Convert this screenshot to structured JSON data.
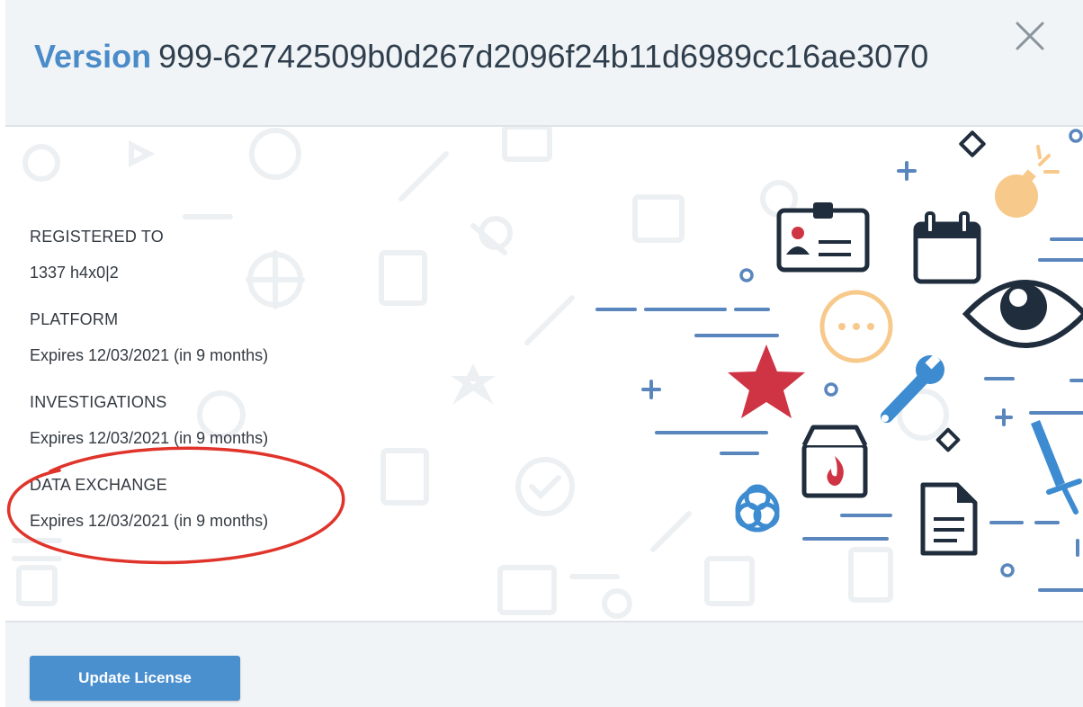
{
  "modal": {
    "title_keyword": "Version",
    "title_value": "999-62742509b0d267d2096f24b11d6989cc16ae3070",
    "close_icon": "close-icon"
  },
  "license": {
    "registered_label": "REGISTERED TO",
    "registered_value": "1337 h4x0|2",
    "sections": [
      {
        "label": "PLATFORM",
        "value": "Expires 12/03/2021 (in 9 months)"
      },
      {
        "label": "INVESTIGATIONS",
        "value": "Expires 12/03/2021 (in 9 months)"
      },
      {
        "label": "DATA EXCHANGE",
        "value": "Expires 12/03/2021 (in 9 months)"
      }
    ]
  },
  "annotation": {
    "color": "#e0342b",
    "target": "DATA EXCHANGE"
  },
  "illustration": {
    "icons": [
      "id-card-icon",
      "calendar-icon",
      "eye-icon",
      "bomb-icon",
      "chat-bubble-icon",
      "star-icon",
      "wrench-icon",
      "fire-box-icon",
      "biohazard-icon",
      "document-icon",
      "sword-icon"
    ],
    "colors": {
      "navy": "#1f2d3d",
      "blue": "#3d8bd0",
      "red": "#cf3444",
      "peach": "#f7c98a",
      "line": "#5a86be"
    }
  },
  "footer": {
    "update_label": "Update License"
  },
  "colors": {
    "accent": "#4a8bc9",
    "button": "#4a90cf",
    "header_bg": "#f1f4f6"
  }
}
